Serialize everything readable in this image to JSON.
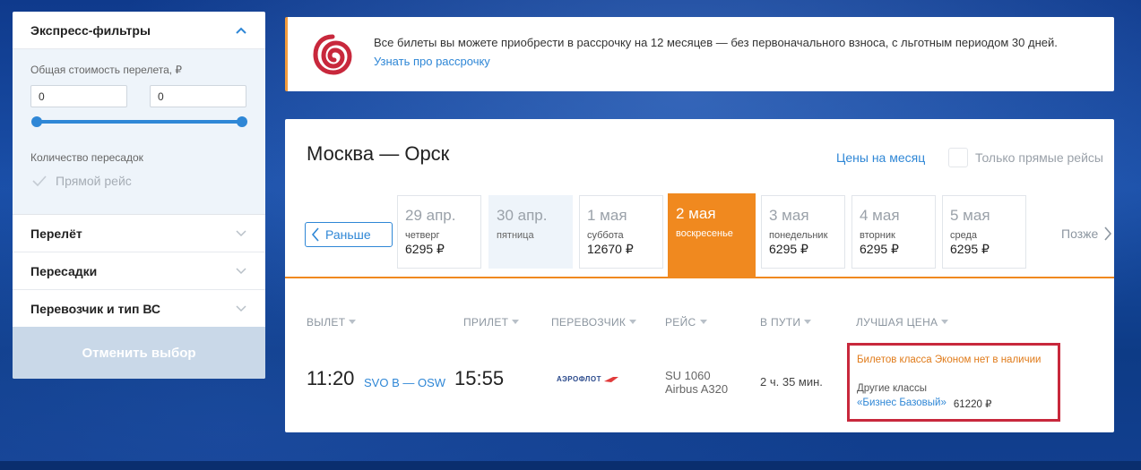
{
  "sidebar": {
    "express_title": "Экспресс-фильтры",
    "price_label": "Общая стоимость перелета, ₽",
    "price_min": "0",
    "price_max": "0",
    "transfers_label": "Количество пересадок",
    "direct_label": "Прямой рейс",
    "sections": [
      {
        "label": "Перелёт"
      },
      {
        "label": "Пересадки"
      },
      {
        "label": "Перевозчик и тип ВС"
      }
    ],
    "cancel_label": "Отменить выбор"
  },
  "banner": {
    "text": "Все билеты вы можете приобрести в рассрочку на 12 месяцев — без первоначального взноса, с льготным периодом 30 дней.",
    "link": "Узнать про рассрочку",
    "logo_color": "#c8283c"
  },
  "route": {
    "title": "Москва — Орск",
    "month_prices": "Цены на месяц",
    "direct_only": "Только прямые рейсы",
    "earlier": "Раньше",
    "later": "Позже"
  },
  "dates": [
    {
      "date": "29 апр.",
      "weekday": "четверг",
      "price": "6295 ₽",
      "state": "normal"
    },
    {
      "date": "30 апр.",
      "weekday": "пятница",
      "price": "",
      "state": "dim"
    },
    {
      "date": "1 мая",
      "weekday": "суббота",
      "price": "12670 ₽",
      "state": "normal"
    },
    {
      "date": "2 мая",
      "weekday": "воскресенье",
      "price": "",
      "state": "active"
    },
    {
      "date": "3 мая",
      "weekday": "понедельник",
      "price": "6295 ₽",
      "state": "normal"
    },
    {
      "date": "4 мая",
      "weekday": "вторник",
      "price": "6295 ₽",
      "state": "normal"
    },
    {
      "date": "5 мая",
      "weekday": "среда",
      "price": "6295 ₽",
      "state": "normal"
    }
  ],
  "columns": {
    "departure": "ВЫЛЕТ",
    "arrival": "ПРИЛЕТ",
    "carrier": "ПЕРЕВОЗЧИК",
    "flight": "РЕЙС",
    "duration": "В ПУТИ",
    "best_price": "ЛУЧШАЯ ЦЕНА"
  },
  "flight": {
    "dep_time": "11:20",
    "airports": "SVO B — OSW",
    "arr_time": "15:55",
    "airline": "АЭРОФЛОТ",
    "flight_no": "SU 1060",
    "aircraft": "Airbus A320",
    "duration": "2 ч. 35 мин.",
    "no_economy": "Билетов класса Эконом нет в наличии",
    "other_classes": "Другие классы",
    "business_fare": "«Бизнес Базовый»",
    "business_price": "61220 ₽"
  },
  "colors": {
    "accent_blue": "#2f87d6",
    "accent_orange": "#f0891f",
    "highlight_red": "#c8283c"
  }
}
